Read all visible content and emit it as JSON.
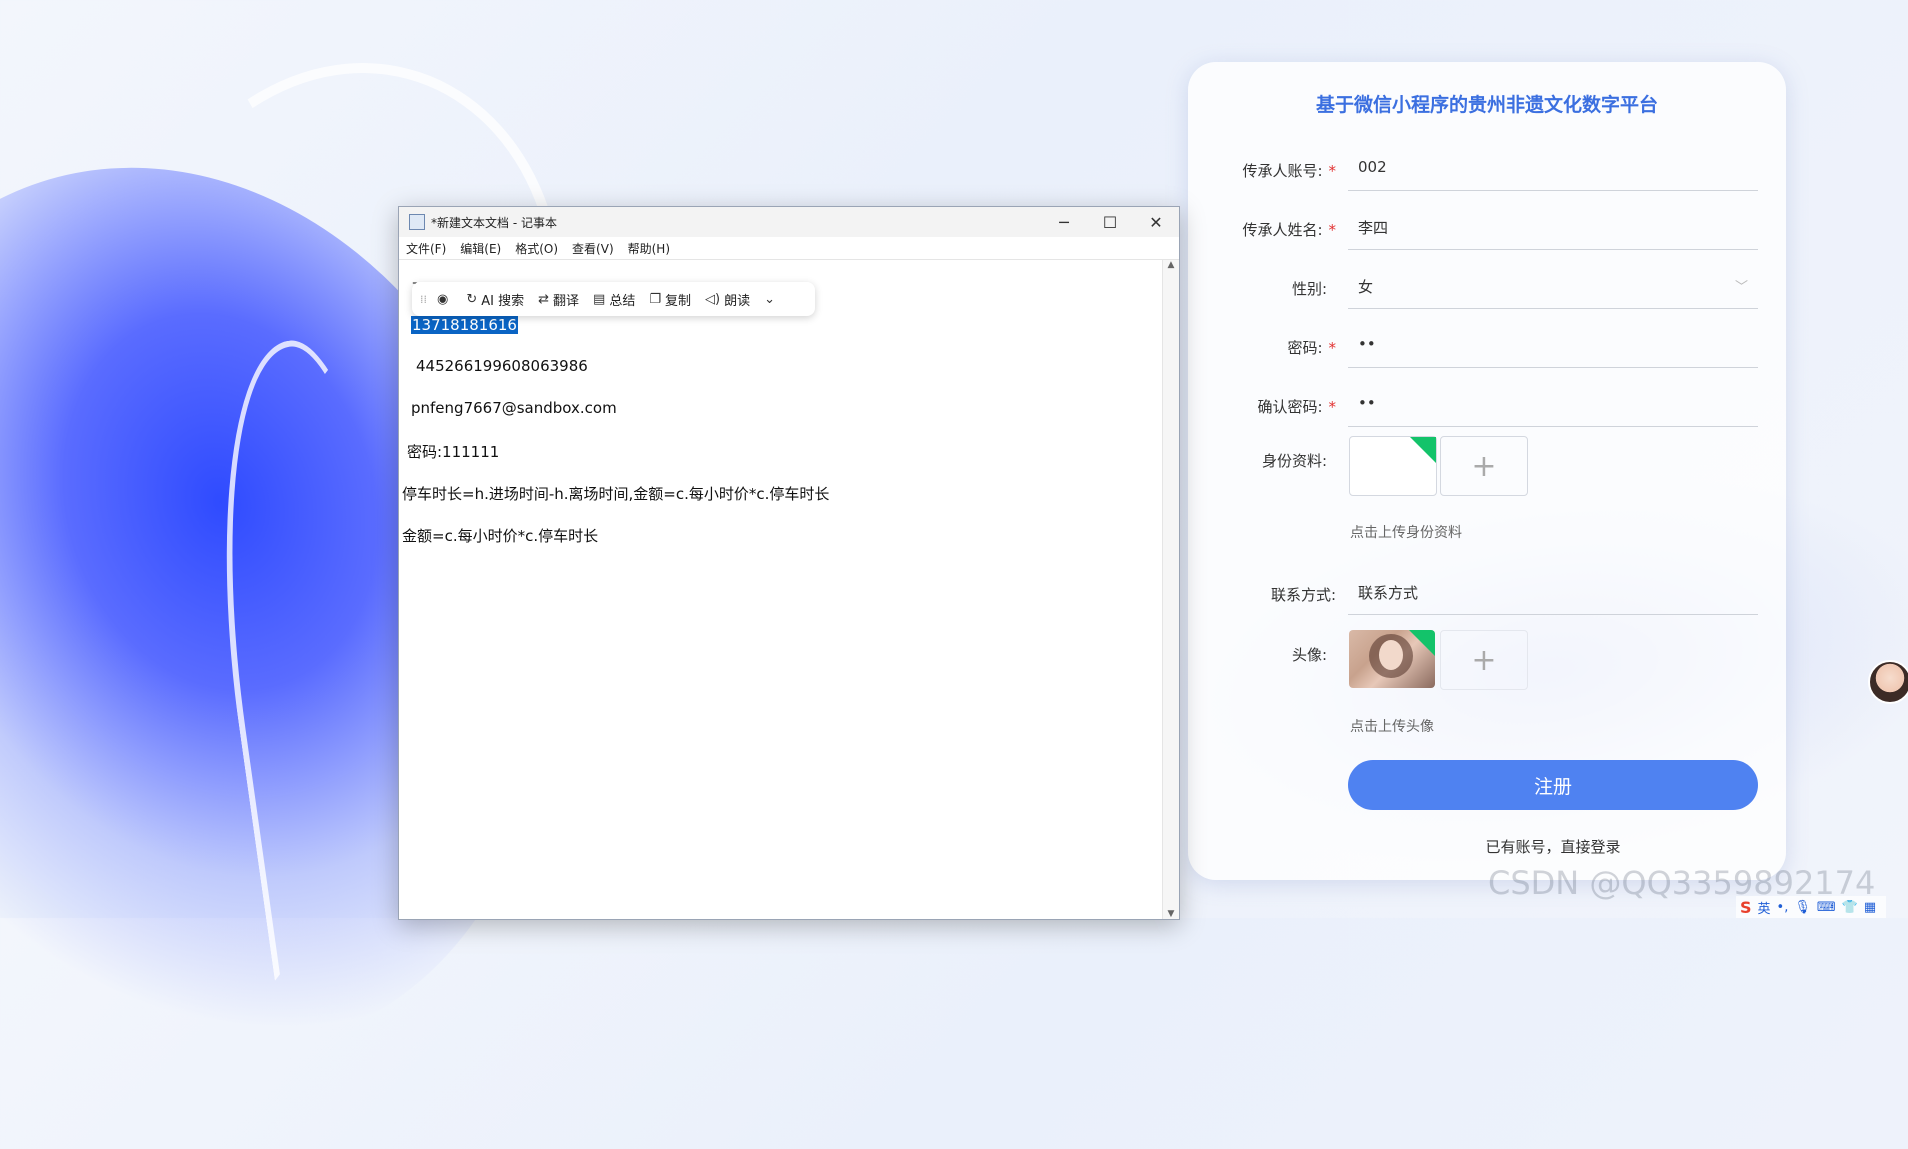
{
  "notepad": {
    "title": "*新建文本文档 - 记事本",
    "controls": {
      "minimize": "─",
      "maximize": "☐",
      "close": "✕"
    },
    "menus": [
      "文件(F)",
      "编辑(E)",
      "格式(O)",
      "查看(V)",
      "帮助(H)"
    ],
    "lines": {
      "partial": "己",
      "phone": "13718181616",
      "id_number": "445266199608063986",
      "email": "pnfeng7667@sandbox.com",
      "password": "密码:111111",
      "formula1": "停车时长=h.进场时间-h.离场时间,金额=c.每小时价*c.停车时长",
      "formula2": "金额=c.每小时价*c.停车时长"
    },
    "ai_toolbar": {
      "items": [
        {
          "icon": "search-icon",
          "label": "AI 搜索"
        },
        {
          "icon": "translate-icon",
          "label": "翻译"
        },
        {
          "icon": "summary-icon",
          "label": "总结"
        },
        {
          "icon": "copy-icon",
          "label": "复制"
        },
        {
          "icon": "speaker-icon",
          "label": "朗读"
        }
      ]
    }
  },
  "register": {
    "title": "基于微信小程序的贵州非遗文化数字平台",
    "fields": {
      "account": {
        "label": "传承人账号:",
        "value": "002",
        "required": true
      },
      "name": {
        "label": "传承人姓名:",
        "value": "李四",
        "required": true
      },
      "gender": {
        "label": "性别:",
        "value": "女",
        "required": false
      },
      "password": {
        "label": "密码:",
        "value": "••",
        "required": true
      },
      "confirm_password": {
        "label": "确认密码:",
        "value": "••",
        "required": true
      },
      "id_docs": {
        "label": "身份资料:",
        "hint": "点击上传身份资料"
      },
      "contact": {
        "label": "联系方式:",
        "value": "联系方式"
      },
      "avatar": {
        "label": "头像:",
        "hint": "点击上传头像"
      }
    },
    "submit_label": "注册",
    "login_link": "已有账号，直接登录"
  },
  "watermark": "CSDN @QQ3359892174",
  "tray": {
    "ime": "英",
    "items": [
      "•,",
      "mic-icon",
      "keyboard-icon",
      "shirt-icon",
      "grid-icon"
    ]
  }
}
